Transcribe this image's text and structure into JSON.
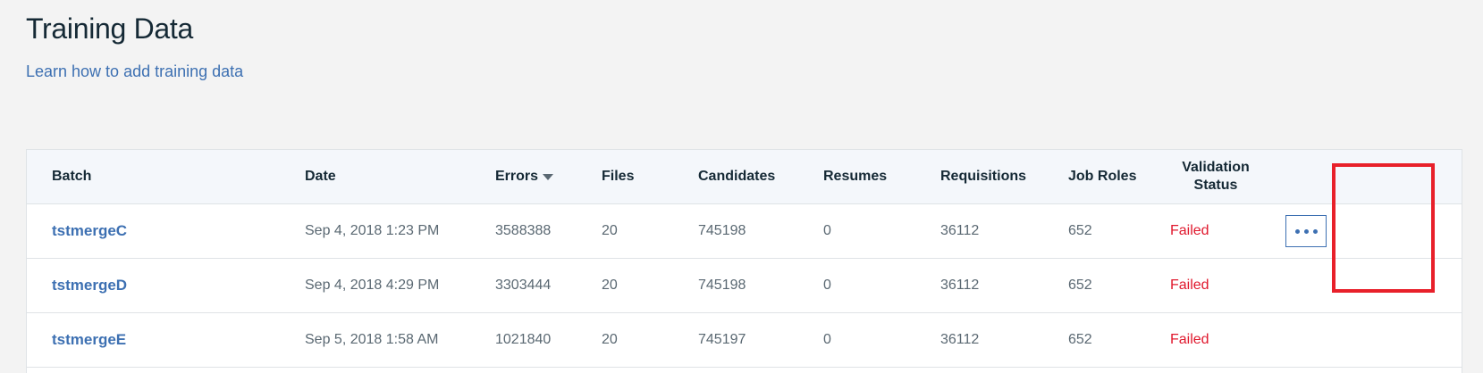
{
  "page": {
    "title": "Training Data",
    "learn_link": "Learn how to add training data"
  },
  "table": {
    "columns": {
      "batch": "Batch",
      "date": "Date",
      "errors": "Errors",
      "files": "Files",
      "candidates": "Candidates",
      "resumes": "Resumes",
      "requisitions": "Requisitions",
      "job_roles": "Job Roles",
      "validation_status_line1": "Validation",
      "validation_status_line2": "Status"
    },
    "sorted_column": "errors",
    "sort_direction": "descending",
    "rows": [
      {
        "batch": "tstmergeC",
        "date": "Sep 4, 2018 1:23 PM",
        "errors": "3588388",
        "files": "20",
        "candidates": "745198",
        "resumes": "0",
        "requisitions": "36112",
        "job_roles": "652",
        "status": "Failed"
      },
      {
        "batch": "tstmergeD",
        "date": "Sep 4, 2018 4:29 PM",
        "errors": "3303444",
        "files": "20",
        "candidates": "745198",
        "resumes": "0",
        "requisitions": "36112",
        "job_roles": "652",
        "status": "Failed"
      },
      {
        "batch": "tstmergeE",
        "date": "Sep 5, 2018 1:58 AM",
        "errors": "1021840",
        "files": "20",
        "candidates": "745197",
        "resumes": "0",
        "requisitions": "36112",
        "job_roles": "652",
        "status": "Failed"
      }
    ]
  },
  "colors": {
    "link": "#3d70b2",
    "failed": "#e0182d",
    "highlight": "#e8202a",
    "header_bg": "#f4f7fb",
    "page_bg": "#f3f3f3"
  },
  "icons": {
    "overflow_menu": "overflow-menu-icon",
    "sort": "sort-descending-icon"
  }
}
